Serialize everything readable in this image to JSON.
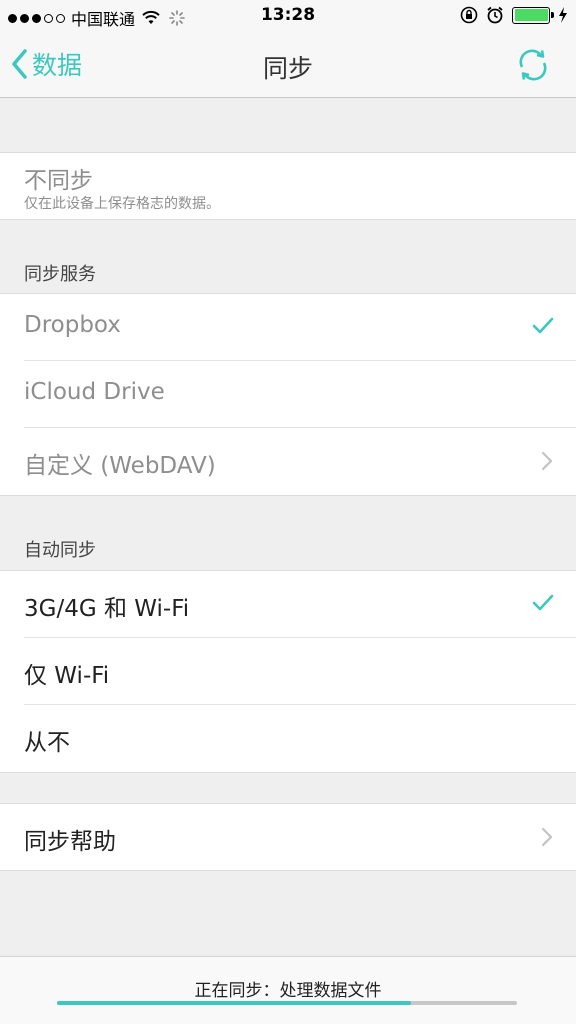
{
  "status_bar": {
    "carrier": "中国联通",
    "time": "13:28",
    "signal_bars_filled": 3,
    "signal_bars_total": 5,
    "battery_level": 1.0
  },
  "nav": {
    "back_label": "数据",
    "title": "同步",
    "accent_color": "#3cc8c0"
  },
  "no_sync": {
    "label": "不同步",
    "description": "仅在此设备上保存格志的数据。"
  },
  "sync_service": {
    "header": "同步服务",
    "items": [
      {
        "label": "Dropbox",
        "checked": true
      },
      {
        "label": "iCloud Drive",
        "checked": false
      },
      {
        "label": "自定义 (WebDAV)",
        "disclosure": true
      }
    ]
  },
  "auto_sync": {
    "header": "自动同步",
    "items": [
      {
        "label": "3G/4G 和 Wi-Fi",
        "checked": true
      },
      {
        "label": "仅 Wi-Fi",
        "checked": false
      },
      {
        "label": "从不",
        "checked": false
      }
    ]
  },
  "help": {
    "label": "同步帮助"
  },
  "footer": {
    "status_text": "正在同步：处理数据文件",
    "progress": 0.77
  }
}
